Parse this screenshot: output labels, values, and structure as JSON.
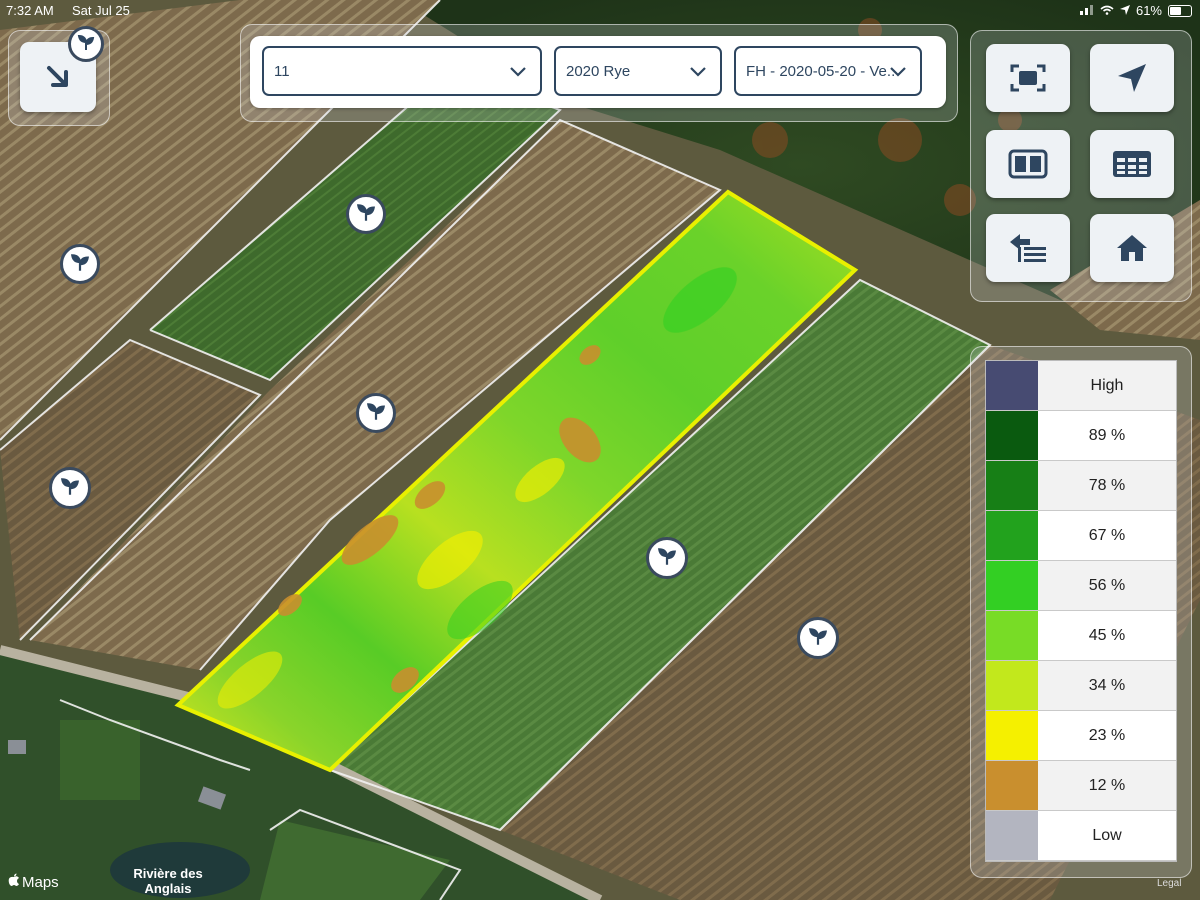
{
  "status_bar": {
    "time": "7:32 AM",
    "date": "Sat Jul 25",
    "battery": "61%",
    "battery_level": 0.61
  },
  "filters": {
    "field": "11",
    "crop": "2020 Rye",
    "layer": "FH - 2020-05-20 - Ve..."
  },
  "toolbar": {
    "collapse_icon": "arrow-down-right-icon",
    "buttons": [
      "fullscreen-icon",
      "locate-icon",
      "split-view-icon",
      "table-icon",
      "layers-back-icon",
      "home-icon"
    ]
  },
  "legend": {
    "items": [
      {
        "label": "High",
        "color": "#474b72"
      },
      {
        "label": "89 %",
        "color": "#0a5a0f"
      },
      {
        "label": "78 %",
        "color": "#177f16"
      },
      {
        "label": "67 %",
        "color": "#22a21d"
      },
      {
        "label": "56 %",
        "color": "#33cf23"
      },
      {
        "label": "45 %",
        "color": "#78dc26"
      },
      {
        "label": "34 %",
        "color": "#c2e81c"
      },
      {
        "label": "23 %",
        "color": "#f5f000"
      },
      {
        "label": "12 %",
        "color": "#c98f2e"
      },
      {
        "label": "Low",
        "color": "#b3b5c0"
      }
    ]
  },
  "map": {
    "place_label": "Rivière des Anglais",
    "place_label_line1": "Rivière des",
    "place_label_line2": "Anglais",
    "attribution": "Maps",
    "legal": "Legal",
    "field_marker_icon": "plant-icon"
  }
}
